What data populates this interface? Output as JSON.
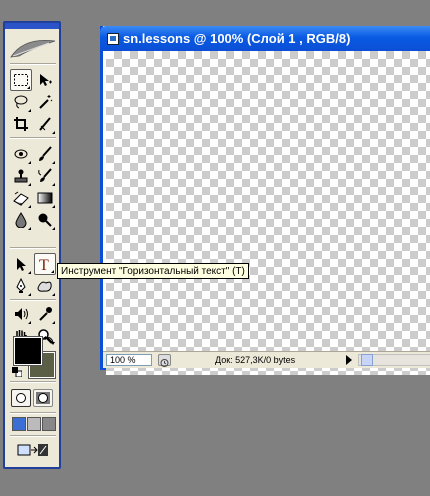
{
  "document": {
    "title": "sn.lessons @ 100% (Слой 1 , RGB/8)",
    "zoom": "100 %",
    "info": "Док: 527,3K/0 bytes"
  },
  "tooltip": {
    "text": "Инструмент \"Горизонтальный текст\" (T)"
  },
  "toolbox": {
    "tools": [
      "rectangular-marquee",
      "move",
      "lasso",
      "magic-wand",
      "crop",
      "slice",
      "spot-healing-brush",
      "brush",
      "clone-stamp",
      "history-brush",
      "eraser",
      "gradient",
      "blur",
      "dodge",
      "path-selection",
      "horizontal-type",
      "pen",
      "custom-shape",
      "notes",
      "eyedropper",
      "hand",
      "zoom"
    ],
    "foreground_color": "#000000",
    "background_color": "#5b5f45"
  },
  "colors": {
    "title_bar": "#0b4fd6",
    "toolbox_bg": "#ece9d8",
    "workspace": "#808080",
    "tooltip_bg": "#ffffe1"
  }
}
